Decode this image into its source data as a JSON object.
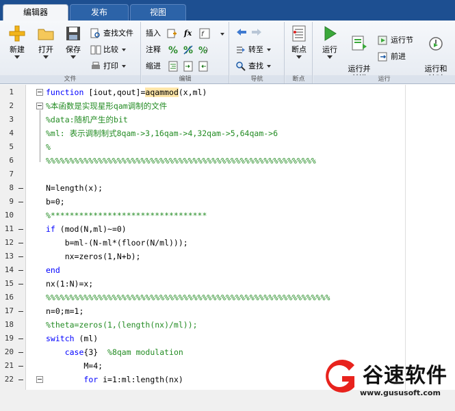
{
  "tabs": [
    {
      "label": "编辑器",
      "active": true
    },
    {
      "label": "发布",
      "active": false
    },
    {
      "label": "视图",
      "active": false
    }
  ],
  "ribbon": {
    "file": {
      "group_label": "文件",
      "new": "新建",
      "open": "打开",
      "save": "保存",
      "find_files": "查找文件",
      "compare": "比较",
      "print": "打印"
    },
    "edit": {
      "group_label": "编辑",
      "insert": "插入",
      "comment": "注释",
      "indent": "缩进",
      "fx": "fx"
    },
    "navigate": {
      "group_label": "导航",
      "goto": "转至",
      "find": "查找"
    },
    "breakpoints": {
      "group_label": "断点",
      "breakpoints": "断点"
    },
    "run": {
      "group_label": "运行",
      "run": "运行",
      "run_and_advance": "运行并\n前进",
      "run_section": "运行节",
      "advance": "前进",
      "run_and_time": "运行和\n计时"
    }
  },
  "editor": {
    "lines": [
      {
        "n": "1",
        "code": "function [iout,qout]=aqammod(x,ml)"
      },
      {
        "n": "2",
        "code": "%本函数是实现星形qam调制的文件"
      },
      {
        "n": "3",
        "code": "%data:随机产生的bit"
      },
      {
        "n": "4",
        "code": "%ml: 表示调制制式8qam->3,16qam->4,32qam->5,64qam->6"
      },
      {
        "n": "5",
        "code": "%"
      },
      {
        "n": "6",
        "code": "%%%%%%%%%%%%%%%%%%%%%%%%%%%%%%%%%%%%%%%%%%%%%%%%%%%%%%%%%"
      },
      {
        "n": "7",
        "code": ""
      },
      {
        "n": "8",
        "code": "N=length(x);"
      },
      {
        "n": "9",
        "code": "b=0;"
      },
      {
        "n": "10",
        "code": "%*********************************"
      },
      {
        "n": "11",
        "code": "if (mod(N,ml)~=0)"
      },
      {
        "n": "12",
        "code": "    b=ml-(N-ml*(floor(N/ml)));"
      },
      {
        "n": "13",
        "code": "    nx=zeros(1,N+b);"
      },
      {
        "n": "14",
        "code": "end"
      },
      {
        "n": "15",
        "code": "nx(1:N)=x;"
      },
      {
        "n": "16",
        "code": "%%%%%%%%%%%%%%%%%%%%%%%%%%%%%%%%%%%%%%%%%%%%%%%%%%%%%%%%%%%%"
      },
      {
        "n": "17",
        "code": "n=0;m=1;"
      },
      {
        "n": "18",
        "code": "%theta=zeros(1,(length(nx)/ml));"
      },
      {
        "n": "19",
        "code": "switch (ml)"
      },
      {
        "n": "20",
        "code": "    case{3}  %8qam modulation"
      },
      {
        "n": "21",
        "code": "        M=4;"
      },
      {
        "n": "22",
        "code": "        for i=1:ml:length(nx)"
      }
    ]
  },
  "watermark": {
    "text": "谷速软件",
    "url": "www.gususoft.com"
  },
  "colors": {
    "tab_bar": "#1d4f91",
    "keyword": "#0000ff",
    "comment": "#228b22",
    "highlight": "#ffe6a8",
    "watermark_red": "#e8231d"
  }
}
